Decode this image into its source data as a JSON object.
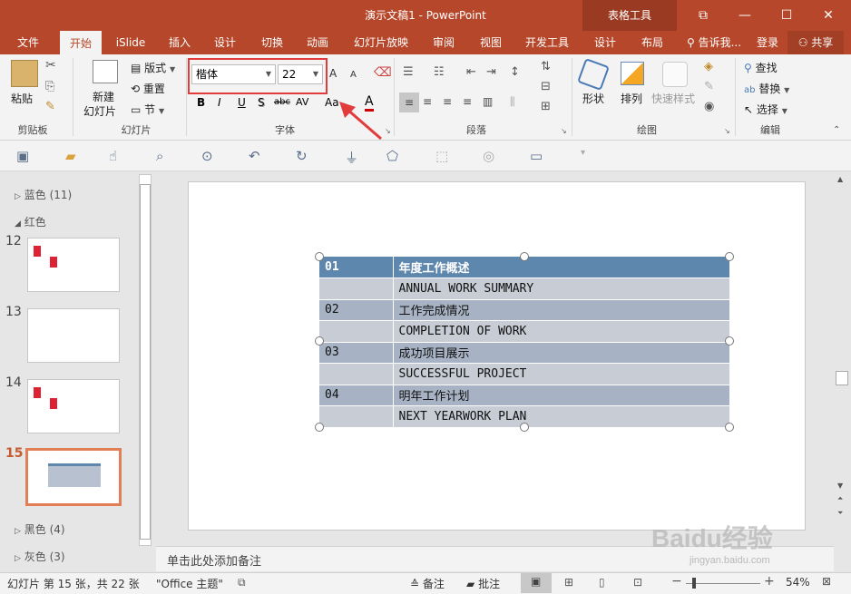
{
  "window": {
    "title": "演示文稿1 - PowerPoint",
    "context_tab": "表格工具"
  },
  "tabs": [
    {
      "label": "文件"
    },
    {
      "label": "开始"
    },
    {
      "label": "iSlide"
    },
    {
      "label": "插入"
    },
    {
      "label": "设计"
    },
    {
      "label": "切换"
    },
    {
      "label": "动画"
    },
    {
      "label": "幻灯片放映"
    },
    {
      "label": "审阅"
    },
    {
      "label": "视图"
    },
    {
      "label": "开发工具"
    },
    {
      "label": "设计"
    },
    {
      "label": "布局"
    }
  ],
  "tellme": "告诉我...",
  "signin": "登录",
  "share": "共享",
  "ribbon": {
    "clipboard": {
      "paste": "粘贴",
      "label": "剪贴板"
    },
    "slides": {
      "new_slide_line1": "新建",
      "new_slide_line2": "幻灯片",
      "layout": "版式",
      "reset": "重置",
      "section": "节",
      "label": "幻灯片"
    },
    "font": {
      "name": "楷体",
      "size": "22",
      "bold": "B",
      "italic": "I",
      "underline": "U",
      "shadow": "S",
      "strike": "abc",
      "spacing": "AV",
      "case": "Aa",
      "color": "A",
      "grow": "A",
      "shrink": "A",
      "label": "字体"
    },
    "paragraph": {
      "label": "段落"
    },
    "drawing": {
      "shape": "形状",
      "arrange": "排列",
      "quickstyle": "快速样式",
      "label": "绘图"
    },
    "editing": {
      "find": "查找",
      "replace": "替换",
      "select": "选择",
      "label": "编辑"
    }
  },
  "panel": {
    "sections": [
      {
        "name": "蓝色 (11)"
      },
      {
        "name": "红色"
      },
      {
        "name": "黑色 (4)"
      },
      {
        "name": "灰色 (3)"
      }
    ],
    "slides": [
      {
        "num": "12"
      },
      {
        "num": "13"
      },
      {
        "num": "14"
      },
      {
        "num": "15"
      }
    ]
  },
  "table": {
    "rows": [
      {
        "c1": "01",
        "c2": "年度工作概述"
      },
      {
        "c1": "",
        "c2": "ANNUAL WORK SUMMARY"
      },
      {
        "c1": "02",
        "c2": "工作完成情况"
      },
      {
        "c1": "",
        "c2": "COMPLETION OF WORK"
      },
      {
        "c1": "03",
        "c2": "成功项目展示"
      },
      {
        "c1": "",
        "c2": "SUCCESSFUL PROJECT"
      },
      {
        "c1": "04",
        "c2": "明年工作计划"
      },
      {
        "c1": "",
        "c2": "NEXT YEARWORK PLAN"
      }
    ]
  },
  "notes": "单击此处添加备注",
  "status": {
    "slide_info": "幻灯片 第 15 张，共 22 张",
    "theme": "\"Office 主题\"",
    "notes": "备注",
    "comments": "批注",
    "zoom": "54%"
  },
  "watermark": {
    "brand": "Baidu经验",
    "url": "jingyan.baidu.com"
  },
  "colors": {
    "accent": "#b7472a",
    "header_row": "#5e87ad",
    "row_odd": "#a7b3c4",
    "row_even": "#c7ccd5",
    "highlight": "#e23b3b"
  }
}
